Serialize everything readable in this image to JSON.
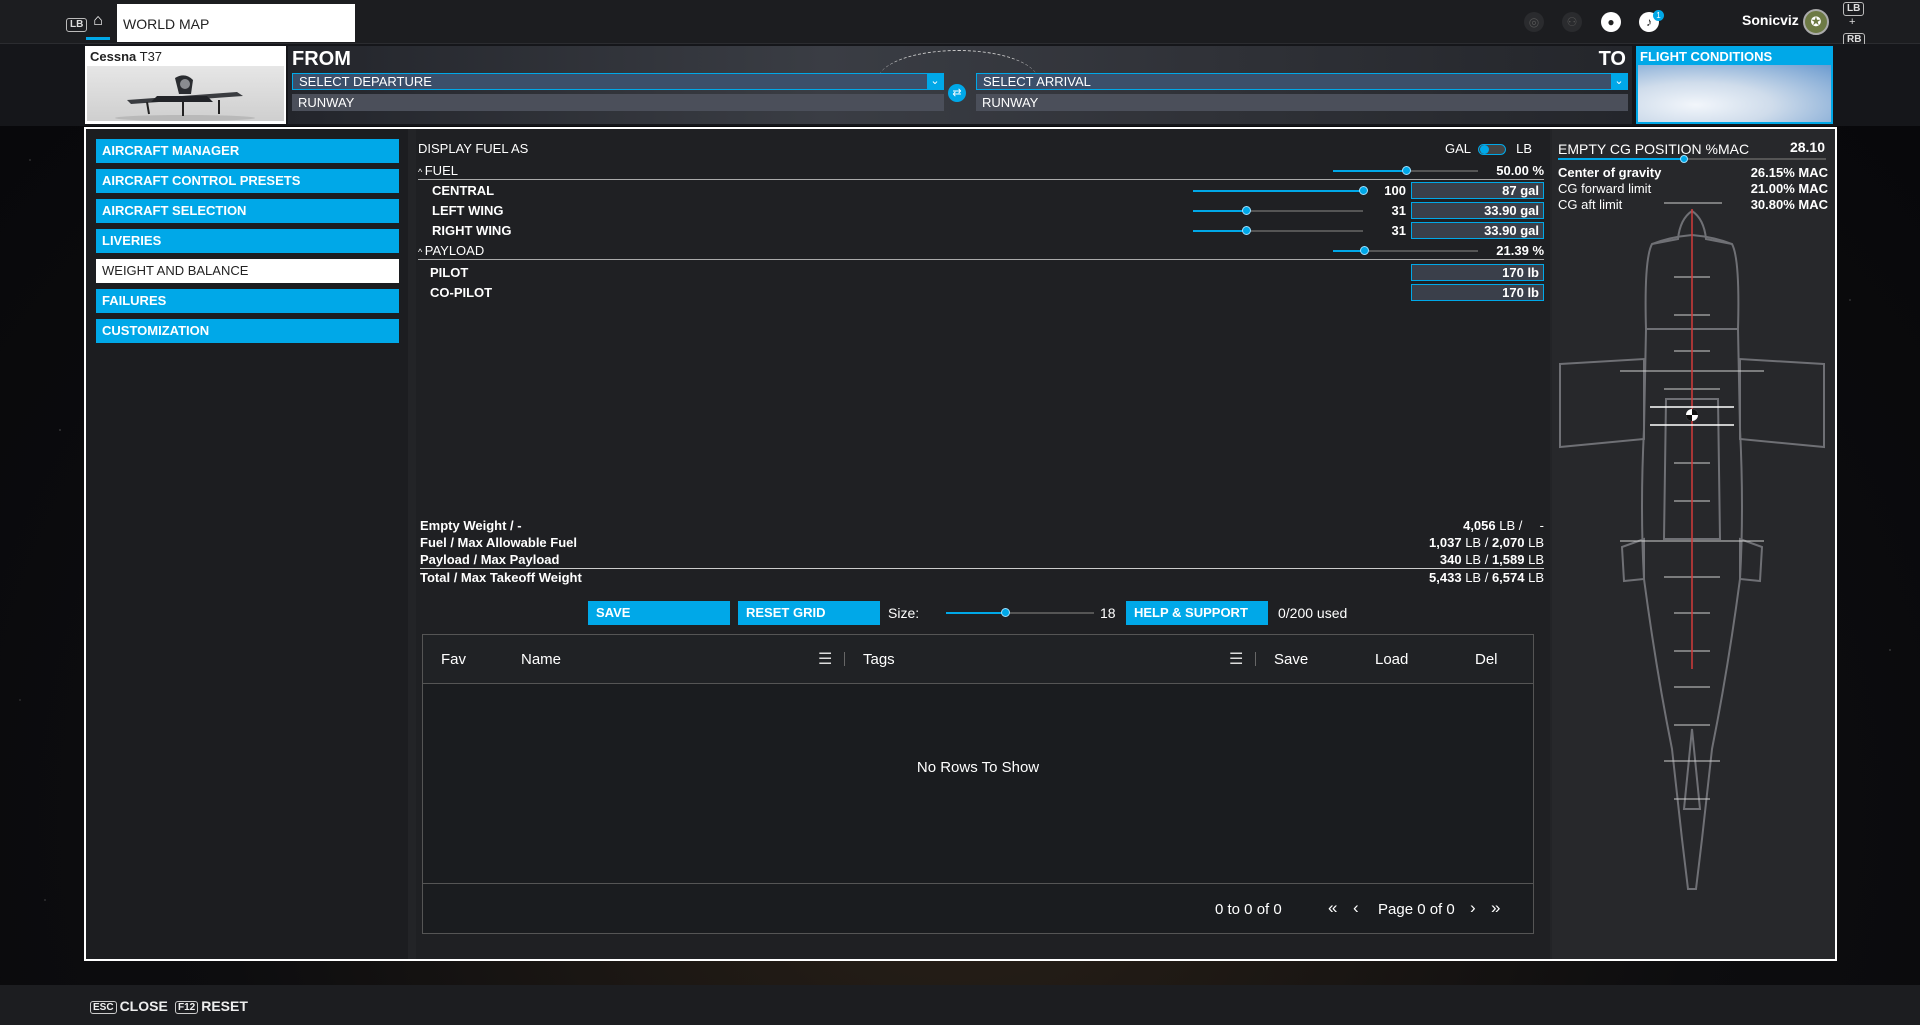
{
  "topbar": {
    "lb_key": "LB",
    "rb_key": "RB",
    "plus": "+",
    "home_icon": "home-icon",
    "tab_label": "WORLD MAP",
    "notification_count": "1",
    "username": "Sonicviz",
    "avatar_glyph": "✪"
  },
  "flight": {
    "aircraft_brand": "Cessna",
    "aircraft_model": "T37",
    "from_label": "FROM",
    "to_label": "TO",
    "departure_placeholder": "SELECT DEPARTURE",
    "arrival_placeholder": "SELECT ARRIVAL",
    "runway_from": "RUNWAY",
    "runway_to": "RUNWAY",
    "conditions_label": "FLIGHT CONDITIONS"
  },
  "sidebar": {
    "items": [
      {
        "label": "AIRCRAFT MANAGER"
      },
      {
        "label": "AIRCRAFT CONTROL PRESETS"
      },
      {
        "label": "AIRCRAFT SELECTION"
      },
      {
        "label": "LIVERIES"
      },
      {
        "label": "WEIGHT AND BALANCE",
        "active": true
      },
      {
        "label": "FAILURES"
      },
      {
        "label": "CUSTOMIZATION"
      }
    ]
  },
  "weight": {
    "display_fuel_as": "DISPLAY FUEL AS",
    "unit_gal": "GAL",
    "unit_lb": "LB",
    "fuel": {
      "label": "FUEL",
      "percent": "50.00 %",
      "level": 0.5
    },
    "tanks": [
      {
        "label": "CENTRAL",
        "value": "100",
        "level": 1.0,
        "amount": "87 gal"
      },
      {
        "label": "LEFT WING",
        "value": "31",
        "level": 0.31,
        "amount": "33.90 gal"
      },
      {
        "label": "RIGHT WING",
        "value": "31",
        "level": 0.31,
        "amount": "33.90 gal"
      }
    ],
    "payload": {
      "label": "PAYLOAD",
      "percent": "21.39 %",
      "level": 0.2139
    },
    "stations": [
      {
        "label": "PILOT",
        "amount": "170 lb"
      },
      {
        "label": "CO-PILOT",
        "amount": "170 lb"
      }
    ],
    "summary": [
      {
        "label": "Empty Weight / -",
        "value": "4,056",
        "unit": " LB / ",
        "max": "",
        "tail": "-"
      },
      {
        "label": "Fuel / Max Allowable Fuel",
        "value": "1,037",
        "unit": " LB / ",
        "max": "2,070",
        "tail": " LB"
      },
      {
        "label": "Payload / Max Payload",
        "value": "340",
        "unit": " LB / ",
        "max": "1,589",
        "tail": " LB"
      },
      {
        "label": "Total / Max Takeoff Weight",
        "value": "5,433",
        "unit": " LB / ",
        "max": "6,574",
        "tail": " LB"
      }
    ]
  },
  "presets": {
    "save_label": "SAVE",
    "reset_grid_label": "RESET GRID",
    "size_label": "Size:",
    "size_value": "18",
    "size_level": 0.4,
    "help_label": "HELP & SUPPORT",
    "used": "0/200 used",
    "columns": [
      "Fav",
      "Name",
      "Tags",
      "Save",
      "Load",
      "Del"
    ],
    "empty_text": "No Rows To Show",
    "range_text": "0 to 0 of 0",
    "page_text": "Page 0 of 0"
  },
  "cg": {
    "title": "EMPTY CG POSITION %MAC",
    "value": "28.10",
    "level": 0.47,
    "rows": [
      {
        "label": "Center of gravity",
        "value": "26.15% MAC",
        "bold": true
      },
      {
        "label": "CG forward limit",
        "value": "21.00% MAC",
        "bold": false
      },
      {
        "label": "CG aft limit",
        "value": "30.80% MAC",
        "bold": false
      }
    ]
  },
  "bottom": {
    "close_key": "ESC",
    "close_label": "CLOSE",
    "reset_key": "F12",
    "reset_label": "RESET"
  },
  "colors": {
    "accent": "#00a8e8",
    "panel": "#1f2023"
  }
}
